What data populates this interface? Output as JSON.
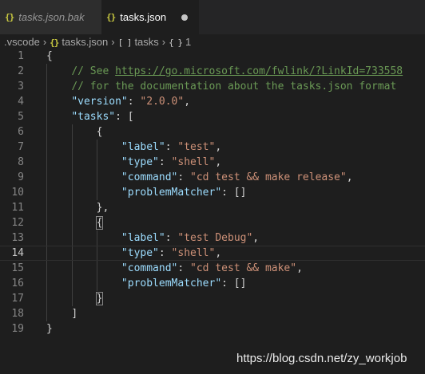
{
  "tabs": [
    {
      "label": "tasks.json.bak",
      "icon": "json-icon",
      "active": false,
      "dirty": false
    },
    {
      "label": "tasks.json",
      "icon": "json-icon",
      "active": true,
      "dirty": true
    }
  ],
  "breadcrumb": {
    "folder": ".vscode",
    "file": "tasks.json",
    "array_symbol": "[ ]",
    "array_name": "tasks",
    "object_symbol": "{ }",
    "object_name": "1"
  },
  "editor": {
    "current_line": 14,
    "line_numbers": [
      "1",
      "2",
      "3",
      "4",
      "5",
      "6",
      "7",
      "8",
      "9",
      "10",
      "11",
      "12",
      "13",
      "14",
      "15",
      "16",
      "17",
      "18",
      "19"
    ],
    "code": {
      "l1_open": "{",
      "l2_comment": "// See ",
      "l2_link": "https://go.microsoft.com/fwlink/?LinkId=733558",
      "l3_comment": "// for the documentation about the tasks.json format",
      "version_key": "\"version\"",
      "version_val": "\"2.0.0\"",
      "tasks_key": "\"tasks\"",
      "label_key": "\"label\"",
      "type_key": "\"type\"",
      "command_key": "\"command\"",
      "problem_key": "\"problemMatcher\"",
      "task1": {
        "label": "\"test\"",
        "type": "\"shell\"",
        "command": "\"cd test && make release\""
      },
      "task2": {
        "label": "\"test Debug\"",
        "type": "\"shell\"",
        "command": "\"cd test && make\""
      }
    }
  },
  "watermark": "https://blog.csdn.net/zy_workjob"
}
